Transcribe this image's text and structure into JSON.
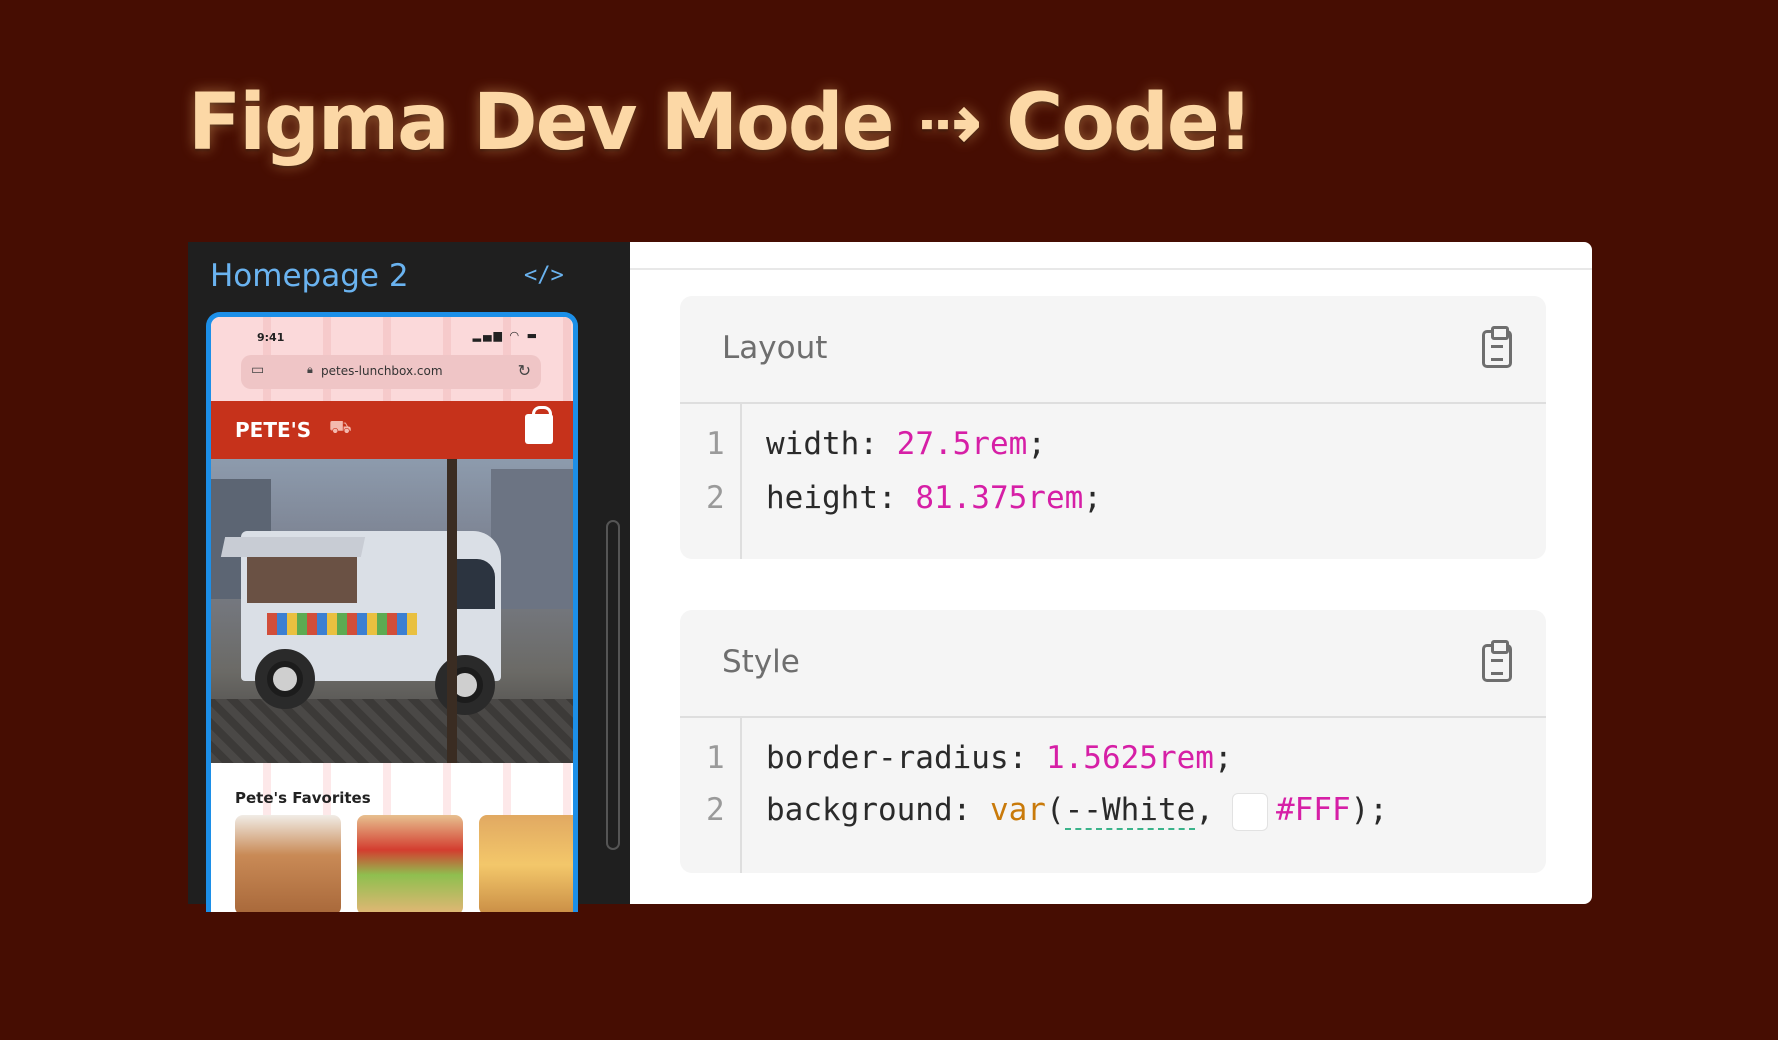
{
  "headline": "Figma Dev Mode ⇢ Code!",
  "frame_panel": {
    "title": "Homepage 2",
    "code_toggle_icon": "code-brackets-icon",
    "phone": {
      "time": "9:41",
      "url": "petes-lunchbox.com",
      "brand": "PETE'S",
      "favorites_title": "Pete's Favorites"
    }
  },
  "layout_section": {
    "title": "Layout",
    "lines": [
      {
        "num": "1",
        "prop": "width: ",
        "value": "27.5rem",
        "end": ";"
      },
      {
        "num": "2",
        "prop": "height: ",
        "value": "81.375rem",
        "end": ";"
      }
    ]
  },
  "style_section": {
    "title": "Style",
    "lines": [
      {
        "num": "1",
        "prop": "border-radius: ",
        "value": "1.5625rem",
        "end": ";"
      },
      {
        "num": "2",
        "prop": "background: ",
        "fn": "var",
        "open": "(",
        "var_name": "--White",
        "sep": ",",
        "value": "#FFF",
        "end": ");"
      }
    ]
  },
  "colors": {
    "page_bg": "#460d02",
    "headline": "#fcd8a6",
    "frame_title": "#6ab3f0",
    "phone_nav": "#c6321b",
    "value_pink": "#d61fa6",
    "value_orange": "#c97a0a"
  }
}
